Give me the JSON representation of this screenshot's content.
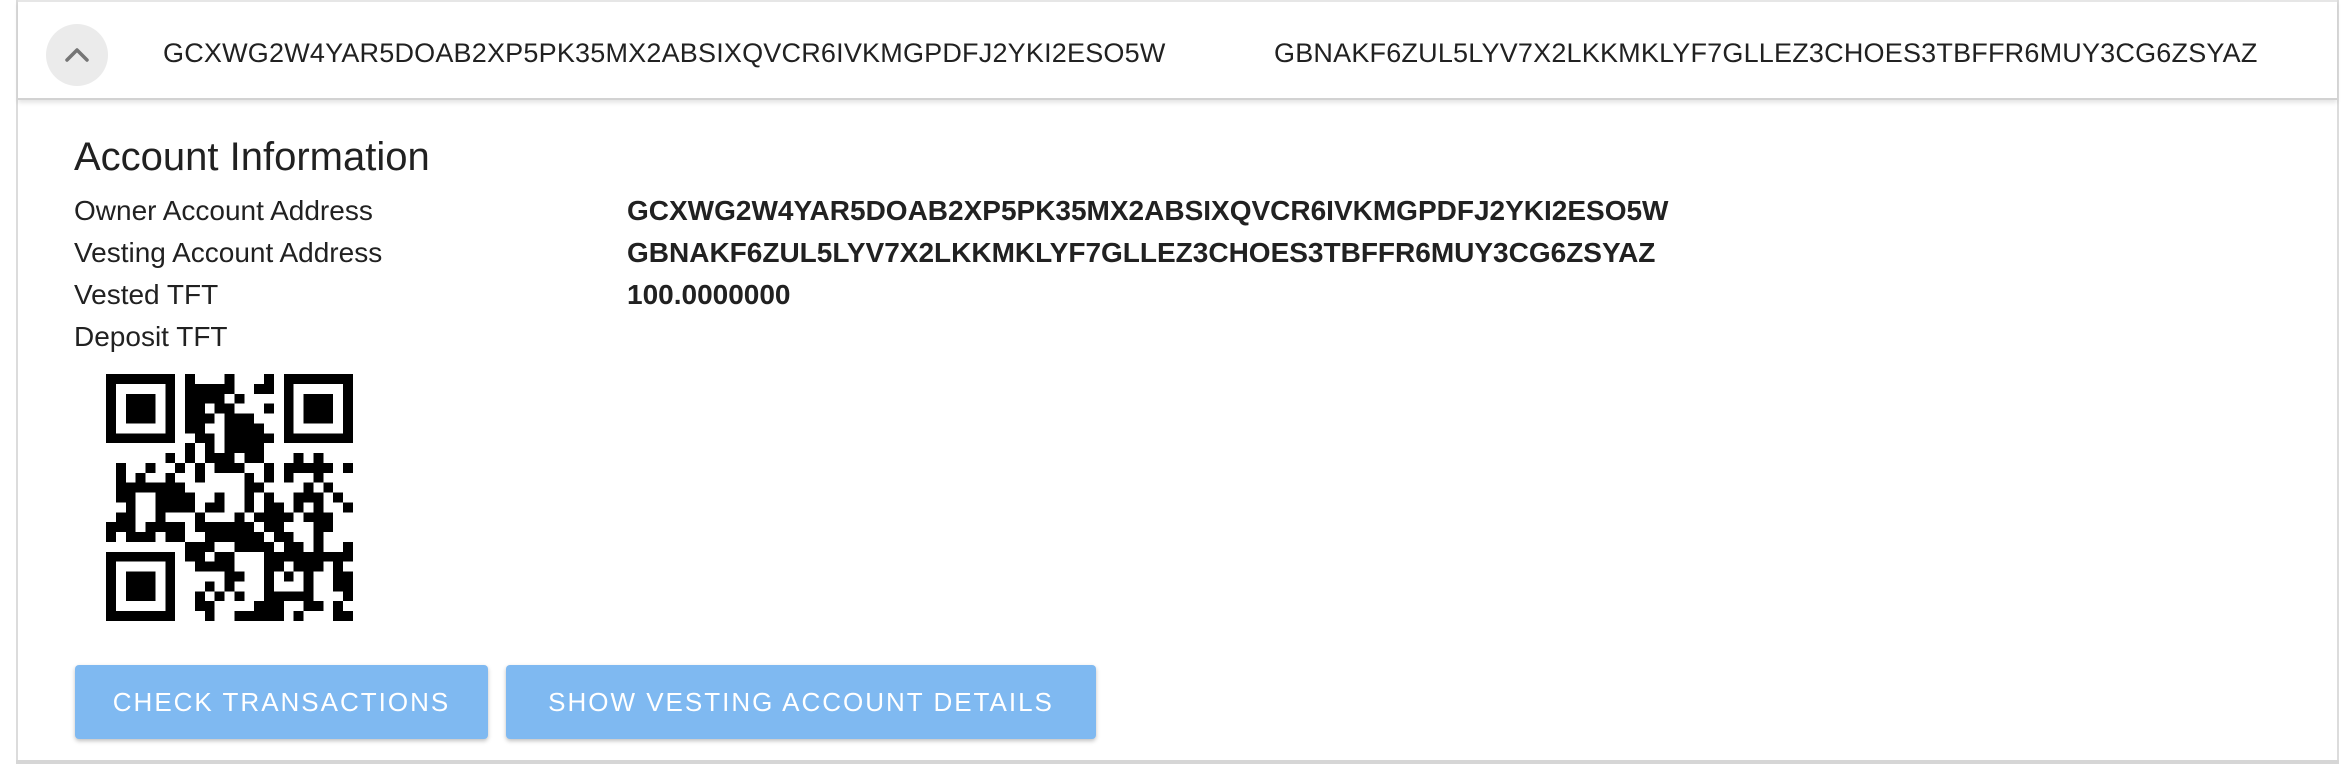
{
  "header": {
    "toggle_icon": "chevron-up-icon",
    "owner_address": "GCXWG2W4YAR5DOAB2XP5PK35MX2ABSIXQVCR6IVKMGPDFJ2YKI2ESO5W",
    "vesting_address": "GBNAKF6ZUL5LYV7X2LKKMKLYF7GLLEZ3CHOES3TBFFR6MUY3CG6ZSYAZ"
  },
  "account": {
    "title": "Account Information",
    "rows": [
      {
        "label": "Owner Account Address",
        "value": "GCXWG2W4YAR5DOAB2XP5PK35MX2ABSIXQVCR6IVKMGPDFJ2YKI2ESO5W"
      },
      {
        "label": "Vesting Account Address",
        "value": "GBNAKF6ZUL5LYV7X2LKKMKLYF7GLLEZ3CHOES3TBFFR6MUY3CG6ZSYAZ"
      },
      {
        "label": "Vested TFT",
        "value": "100.0000000"
      },
      {
        "label": "Deposit TFT",
        "value": ""
      }
    ],
    "qr_icon": "qr-code-icon"
  },
  "actions": {
    "check_transactions": "CHECK TRANSACTIONS",
    "show_vesting_details": "SHOW VESTING ACCOUNT DETAILS"
  },
  "colors": {
    "button_bg": "#7fb9f1",
    "toggle_bg": "#ebebeb"
  }
}
